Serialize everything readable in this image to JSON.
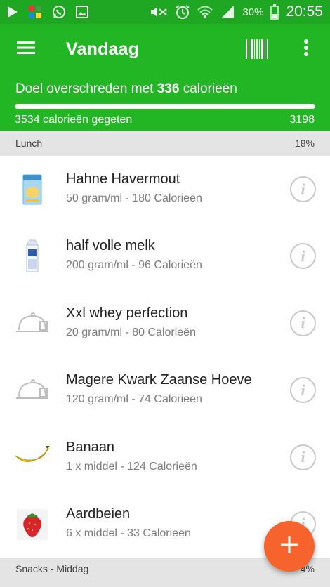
{
  "status_bar": {
    "battery_pct": "30%",
    "time": "20:55",
    "icons": [
      "play-store-icon",
      "app-icon",
      "whatsapp-icon",
      "gallery-icon",
      "mute-icon",
      "alarm-icon",
      "wifi-icon",
      "signal-icon",
      "battery-icon"
    ]
  },
  "app_bar": {
    "title": "Vandaag",
    "icons": [
      "menu-icon",
      "barcode-icon",
      "more-vert-icon"
    ]
  },
  "summary": {
    "goal_prefix": "Doel overschreden met ",
    "goal_amount": "336",
    "goal_suffix": " calorieën",
    "eaten_label": "3534 calorieën gegeten",
    "goal_value": "3198",
    "progress_fraction": 1.0
  },
  "sections": {
    "lunch": {
      "name": "Lunch",
      "pct": "18%"
    },
    "snacks": {
      "name": "Snacks - Middag",
      "pct": "4%"
    }
  },
  "foods": [
    {
      "name": "Hahne Havermout",
      "desc": "50 gram/ml - 180 Calorieën",
      "icon": "oats-package-icon"
    },
    {
      "name": "half volle melk",
      "desc": "200 gram/ml - 96 Calorieën",
      "icon": "milk-carton-icon"
    },
    {
      "name": "Xxl whey perfection",
      "desc": "20 gram/ml - 80 Calorieën",
      "icon": "food-dish-icon"
    },
    {
      "name": "Magere Kwark Zaanse Hoeve",
      "desc": "120 gram/ml - 74 Calorieën",
      "icon": "food-dish-icon"
    },
    {
      "name": "Banaan",
      "desc": "1 x middel - 124 Calorieën",
      "icon": "banana-icon"
    },
    {
      "name": "Aardbeien",
      "desc": "6 x middel - 33 Calorieën",
      "icon": "strawberry-icon"
    }
  ],
  "info_icon_glyph": "i",
  "colors": {
    "status_bar": "#1fa723",
    "primary": "#22b625",
    "section_bg": "#e4e4e4",
    "fab": "#f6632d"
  }
}
